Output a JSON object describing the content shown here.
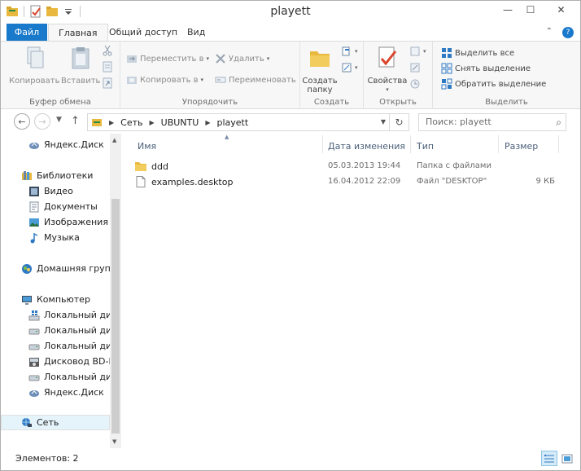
{
  "window": {
    "title": "playett",
    "controls": {
      "minimize": "—",
      "maximize": "☐",
      "close": "✕"
    }
  },
  "ribbon_tabs": {
    "file": "Файл",
    "home": "Главная",
    "share": "Общий доступ",
    "view": "Вид",
    "collapse": "⌃",
    "help": "?"
  },
  "ribbon": {
    "clipboard": {
      "label": "Буфер обмена",
      "copy": "Копировать",
      "paste": "Вставить"
    },
    "organize": {
      "label": "Упорядочить",
      "move_to": "Переместить в",
      "copy_to": "Копировать в",
      "delete": "Удалить",
      "rename": "Переименовать"
    },
    "new": {
      "label": "Создать",
      "new_folder_line1": "Создать",
      "new_folder_line2": "папку"
    },
    "open": {
      "label": "Открыть",
      "properties": "Свойства"
    },
    "select": {
      "label": "Выделить",
      "select_all": "Выделить все",
      "select_none": "Снять выделение",
      "invert_selection": "Обратить выделение"
    }
  },
  "address_bar": {
    "crumbs": [
      "Сеть",
      "UBUNTU",
      "playett"
    ],
    "search_placeholder": "Поиск: playett"
  },
  "nav_pane": {
    "items": [
      {
        "label": "Яндекс.Диск",
        "icon": "yandex-disk-icon"
      },
      {
        "label": "Библиотеки",
        "icon": "libraries-icon"
      },
      {
        "label": "Видео",
        "icon": "video-icon"
      },
      {
        "label": "Документы",
        "icon": "documents-icon"
      },
      {
        "label": "Изображения",
        "icon": "pictures-icon"
      },
      {
        "label": "Музыка",
        "icon": "music-icon"
      },
      {
        "label": "Домашняя группа",
        "icon": "homegroup-icon"
      },
      {
        "label": "Компьютер",
        "icon": "computer-icon"
      },
      {
        "label": "Локальный диск",
        "icon": "windows-drive-icon"
      },
      {
        "label": "Локальный диск",
        "icon": "drive-icon"
      },
      {
        "label": "Локальный диск",
        "icon": "drive-icon"
      },
      {
        "label": "Дисковод BD-RC",
        "icon": "optical-drive-icon"
      },
      {
        "label": "Локальный диск",
        "icon": "drive-icon"
      },
      {
        "label": "Яндекс.Диск",
        "icon": "yandex-disk-icon"
      },
      {
        "label": "Сеть",
        "icon": "network-icon"
      }
    ]
  },
  "file_list": {
    "columns": {
      "name": "Имя",
      "date": "Дата изменения",
      "type": "Тип",
      "size": "Размер"
    },
    "rows": [
      {
        "name": "ddd",
        "date": "05.03.2013 19:44",
        "type": "Папка с файлами",
        "size": "",
        "icon": "folder-icon"
      },
      {
        "name": "examples.desktop",
        "date": "16.04.2012 22:09",
        "type": "Файл \"DESKTOP\"",
        "size": "9 КБ",
        "icon": "file-icon"
      }
    ]
  },
  "status_bar": {
    "item_count": "Элементов: 2"
  },
  "colors": {
    "accent": "#1979ca",
    "folder": "#e8b93e",
    "selection": "#e5f3fb"
  }
}
